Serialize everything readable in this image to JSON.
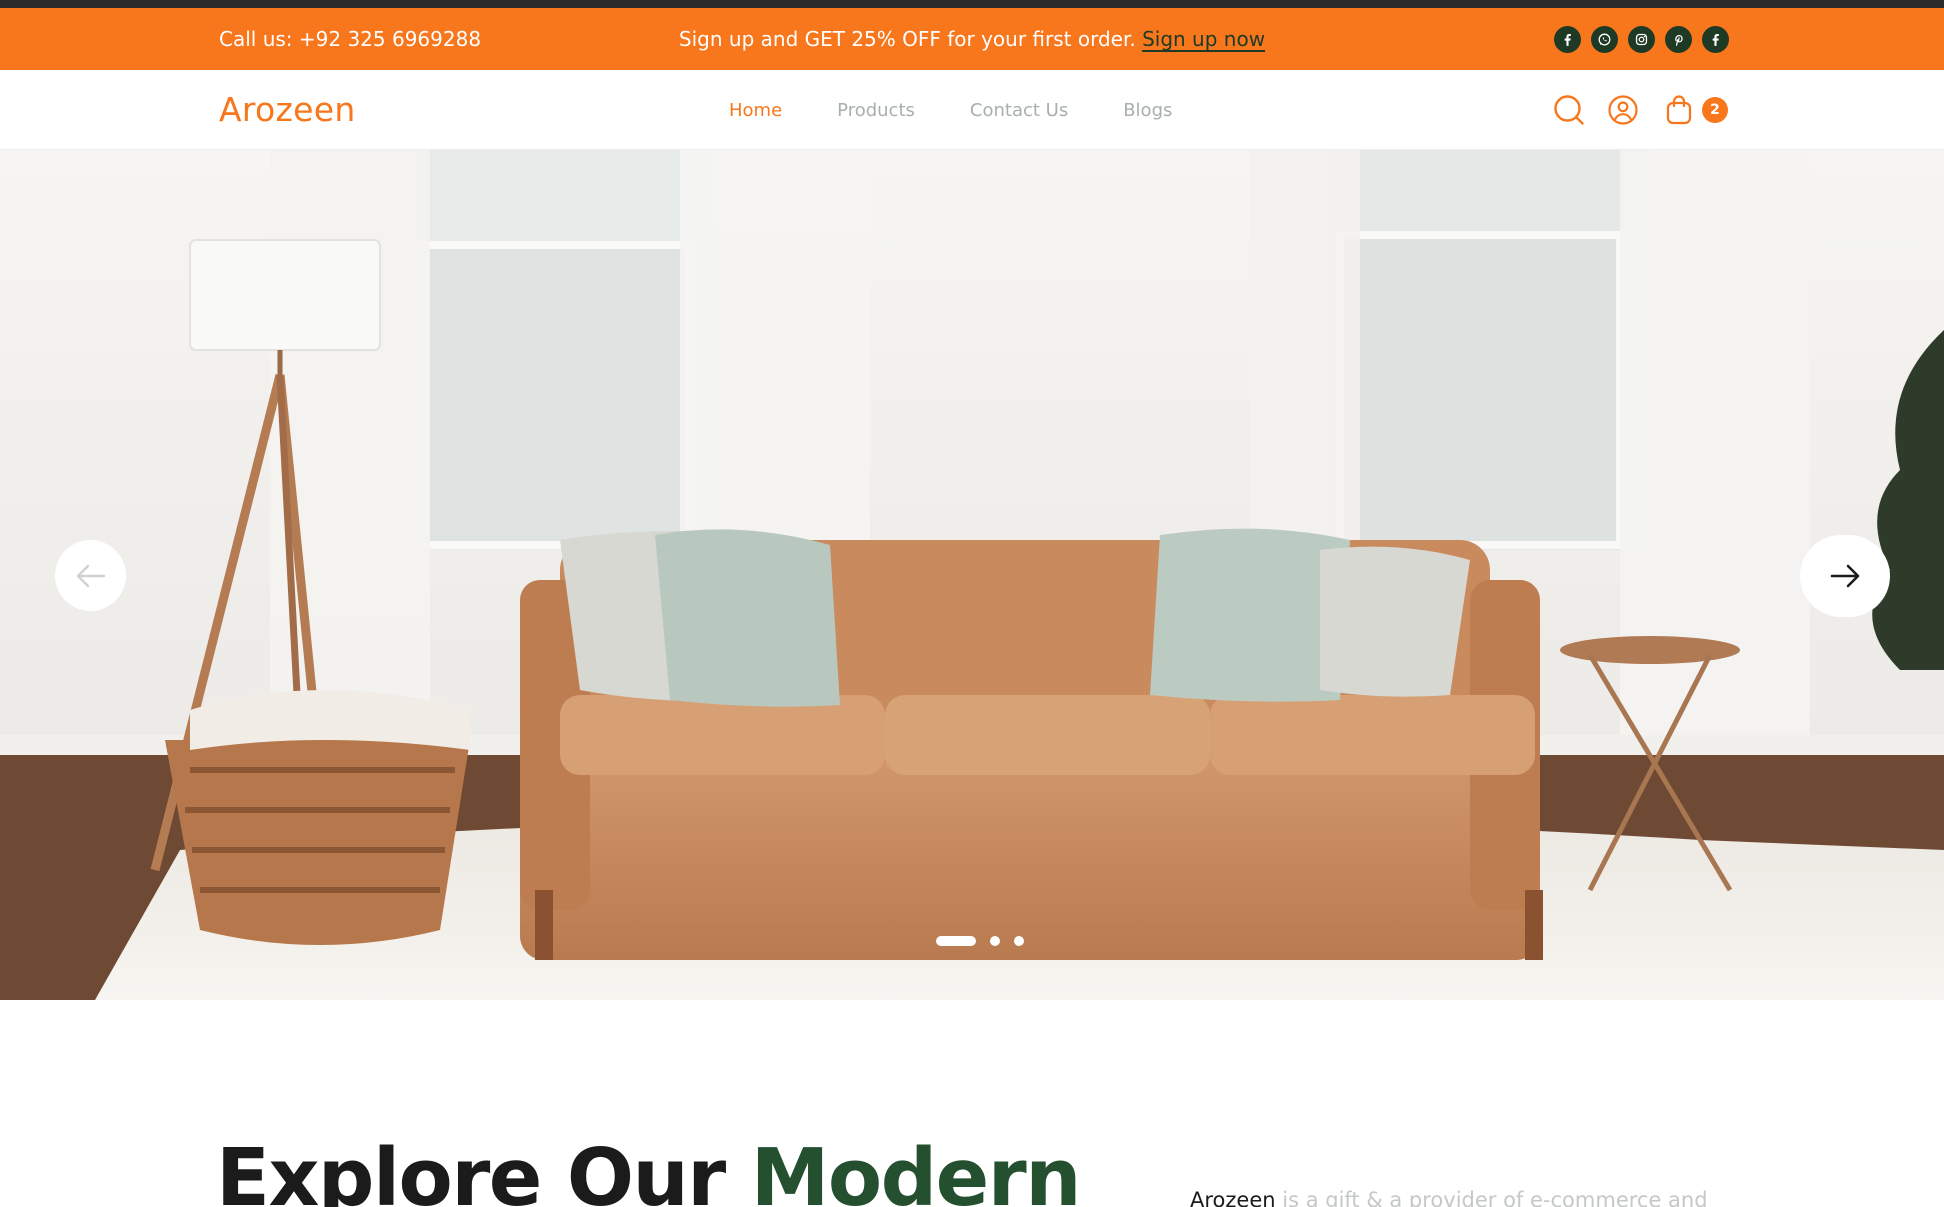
{
  "promo": {
    "call": "Call us: +92 325 6969288",
    "offer": "Sign up and GET 25% OFF for your first order.",
    "signup_link": "Sign up now",
    "socials": [
      "facebook-icon",
      "whatsapp-icon",
      "instagram-icon",
      "pinterest-icon",
      "facebook-icon"
    ]
  },
  "header": {
    "logo": "Arozeen",
    "nav": [
      "Home",
      "Products",
      "Contact Us",
      "Blogs"
    ],
    "active_nav": "Home",
    "cart_count": "2"
  },
  "hero": {
    "slides": 3,
    "active_slide": 1
  },
  "intro": {
    "title_part1": "Explore Our ",
    "title_highlight": "Modern",
    "brand": "Arozeen",
    "text": " is a gift & a provider of e-commerce and"
  },
  "colors": {
    "accent": "#f8761c",
    "dark_green": "#1e3a24",
    "highlight_green": "#24502f",
    "nav_inactive": "#a8b0aa"
  }
}
